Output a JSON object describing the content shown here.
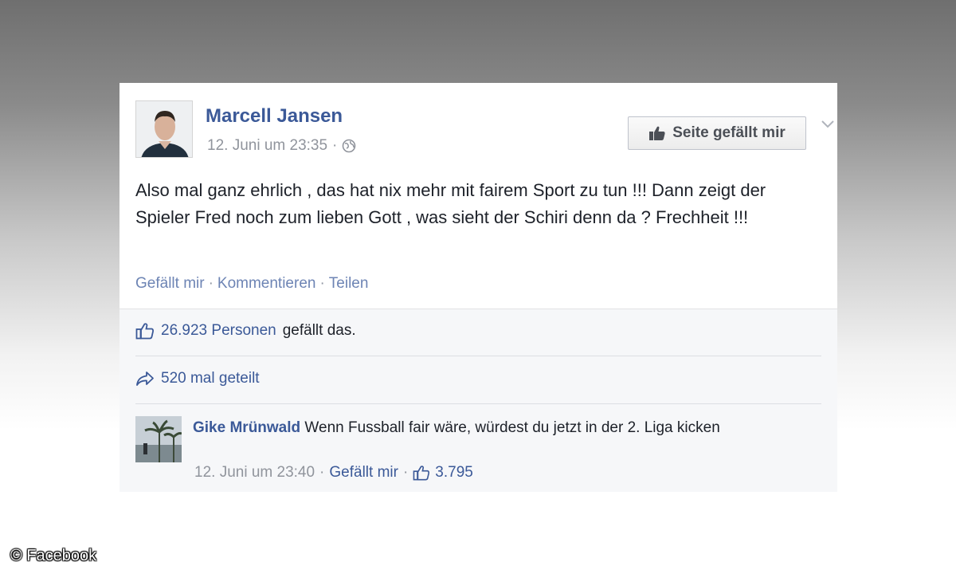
{
  "post": {
    "author": "Marcell Jansen",
    "timestamp": "12. Juni um 23:35",
    "meta_sep": "·",
    "privacy_icon": "globe-icon",
    "like_page_label": "Seite gefällt mir",
    "text": "Also mal ganz ehrlich , das hat nix mehr mit fairem Sport zu tun !!! Dann zeigt der Spieler Fred noch zum lieben Gott , was sieht der Schiri denn da ? Frechheit !!!",
    "actions": {
      "like": "Gefällt mir",
      "comment": "Kommentieren",
      "share": "Teilen",
      "sep": "·"
    }
  },
  "stats": {
    "likes_count": "26.923 Personen",
    "likes_suffix": "gefällt das.",
    "shares": "520 mal geteilt"
  },
  "comment": {
    "author": "Gike Mrünwald",
    "text": "Wenn Fussball fair wäre, würdest du jetzt in der 2. Liga kicken",
    "timestamp": "12. Juni um 23:40",
    "sep": "·",
    "like_label": "Gefällt mir",
    "like_count": "3.795"
  },
  "credit": "© Facebook",
  "colors": {
    "link_blue": "#3b5998",
    "meta_grey": "#90949c",
    "action_blue": "#6d84b4",
    "ufi_bg": "#f6f7f9"
  }
}
